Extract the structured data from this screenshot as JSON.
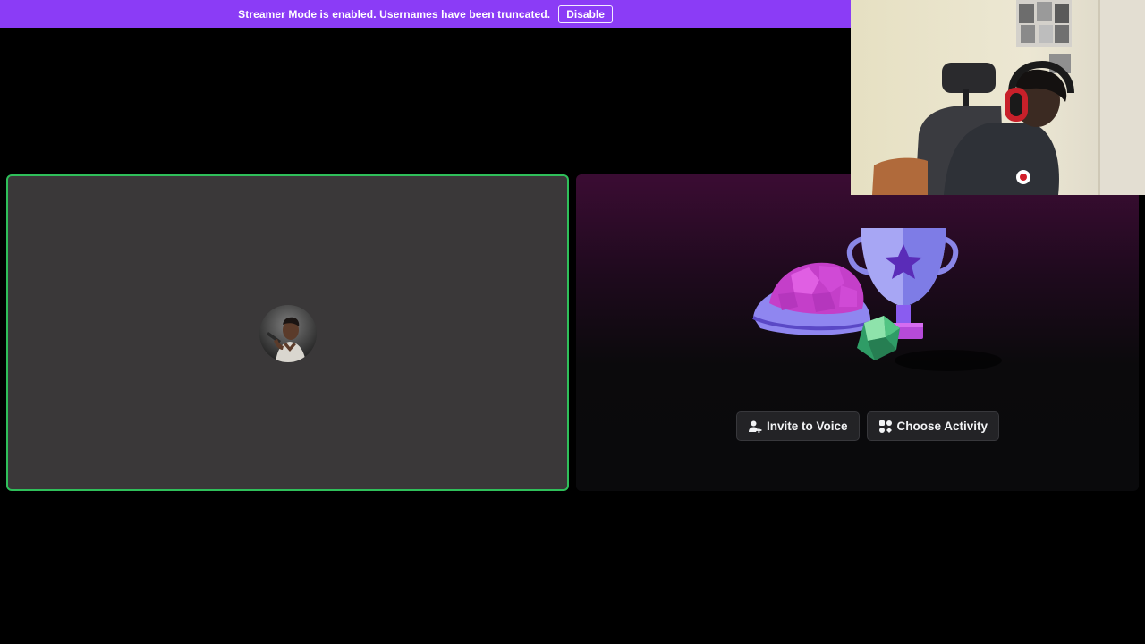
{
  "notice": {
    "message": "Streamer Mode is enabled. Usernames have been truncated.",
    "disable_label": "Disable",
    "background": "#8b3cf6"
  },
  "voice_tile": {
    "speaking_border_color": "#2fbf5a",
    "avatar_icon": "user-avatar"
  },
  "activity": {
    "hero_icons": [
      "turtle-shell-icon",
      "trophy-icon",
      "d20-die-icon"
    ],
    "invite_label": "Invite to Voice",
    "invite_icon": "add-user-icon",
    "choose_label": "Choose Activity",
    "choose_icon": "activities-icon"
  },
  "webcam": {
    "content": "streamer-webcam-feed"
  }
}
